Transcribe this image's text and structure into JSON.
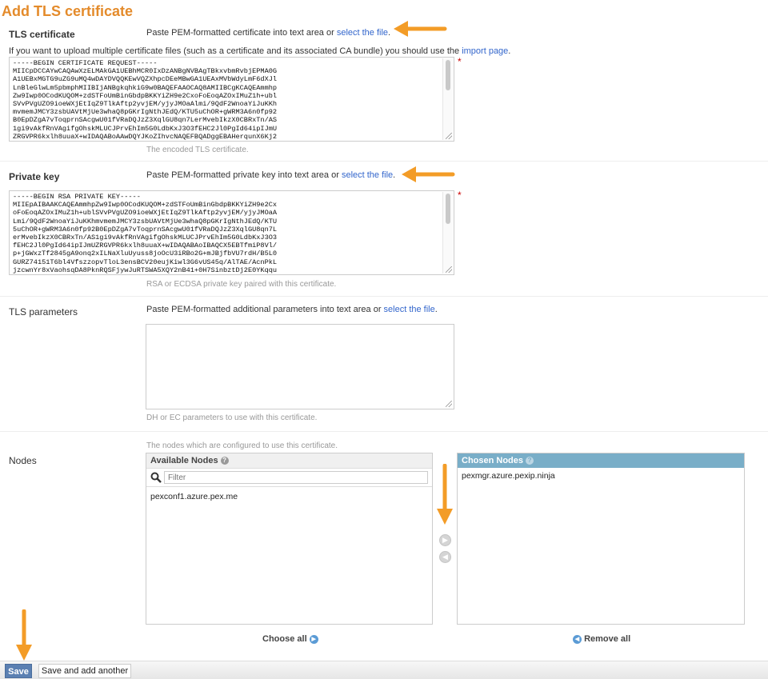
{
  "page": {
    "title": "Add TLS certificate"
  },
  "tls_certificate": {
    "label": "TLS certificate",
    "help_prefix": "Paste PEM-formatted certificate into text area or ",
    "help_link": "select the file",
    "help_suffix": ".",
    "multi_prefix": "If you want to upload multiple certificate files (such as a certificate and its associated CA bundle) you should use the ",
    "multi_link": "import page",
    "multi_suffix": ".",
    "value": "-----BEGIN CERTIFICATE REQUEST-----\nMIICpDCCAYwCAQAwXzELMAkGA1UEBhMCR0IxDzANBgNVBAgTBkxvbmRvbjEPMA0G\nA1UEBxMGTG9uZG9uMQ4wDAYDVQQKEwVQZXhpcDEeMBwGA1UEAxMVbWdyLmF6dXJl\nLnBleGlwLm5pbmphMIIBIjANBgkqhkiG9w0BAQEFAAOCAQ8AMIIBCgKCAQEAmmhp\nZw9Iwp0OCodKUQOM+zdSTFoUmBinGbdpBKKYiZH9e2CxoFoEoqAZOxIMuZ1h+ubl\nSVvPVgUZO9ioeWXjEtIqZ9TlkAftp2yvjEM/yjyJMOaAlmi/9QdF2WnoaYiJuKKh\nmvmemJMCY3zsbUAVtMjUe3whaQ8pGKrIgNthJEdQ/KTU5uChOR+gWRM3A6n0fp92\nB0EpDZgA7vToqprnSAcgwU01fVRaDQJzZ3XqlGU8qn7LerMvebIkzX0CBRxTn/AS\n1gi9vAkfRnVAgifgOhskMLUCJPrvEhIm5G0LdbKxJ3O3fEHC2Jl0PgId64ipIJmU\nZRGVPR6kxlh8uuaX+wIDAQABoAAwDQYJKoZIhvcNAQEFBQADggEBAHerqunX6Kj2",
    "desc": "The encoded TLS certificate.",
    "required_mark": "*"
  },
  "private_key": {
    "label": "Private key",
    "help_prefix": "Paste PEM-formatted private key into text area or ",
    "help_link": "select the file",
    "help_suffix": ".",
    "value": "-----BEGIN RSA PRIVATE KEY-----\nMIIEpAIBAAKCAQEAmmhpZw9Iwp0OCodKUQOM+zdSTFoUmBinGbdpBKKYiZH9e2Cx\noFoEoqAZOxIMuZ1h+ublSVvPVgUZO9ioeWXjEtIqZ9TlkAftp2yvjEM/yjyJMOaA\nLmi/9QdF2WnoaYiJuKKhmvmemJMCY3zsbUAVtMjUe3whaQ8pGKrIgNthJEdQ/KTU\n5uChOR+gWRM3A6n0fp92B0EpDZgA7vToqprnSAcgwU01fVRaDQJzZ3XqlGU8qn7L\nerMvebIkzX0CBRxTn/AS1gi9vAkfRnVAgifgOhskMLUCJPrvEhIm5G0LdbKxJ3O3\nfEHC2Jl0PgId64ipIJmUZRGVPR6kxlh8uuaX+wIDAQABAoIBAQCX5EBTfmiP8Vl/\np+jGWxzTf2845gA9onq2xILNaXluUyuss8joOcU3iRBo2G+mJBjfbVU7rdH/B5L0\nGURZ74151T6bl4VfszzopvTloL3ensBCV20eujKiwl3G6vUS45q/AlTAE/AcnPkL\njzcwnYr8xVaohsqDA8PknRQSFjywJuRTSWA5XQY2nB41+0H7SinbztDj2E0YKqqu",
    "desc": "RSA or ECDSA private key paired with this certificate.",
    "required_mark": "*"
  },
  "tls_parameters": {
    "label": "TLS parameters",
    "help_prefix": "Paste PEM-formatted additional parameters into text area or ",
    "help_link": "select the file",
    "help_suffix": ".",
    "value": "",
    "desc": "DH or EC parameters to use with this certificate."
  },
  "nodes": {
    "label": "Nodes",
    "desc": "The nodes which are configured to use this certificate.",
    "available": {
      "header": "Available Nodes",
      "filter_placeholder": "Filter",
      "items": [
        "pexconf1.azure.pex.me"
      ],
      "choose_all": "Choose all"
    },
    "chosen": {
      "header": "Chosen Nodes",
      "items": [
        "pexmgr.azure.pexip.ninja"
      ],
      "remove_all": "Remove all"
    }
  },
  "actions": {
    "save": "Save",
    "save_and_add": "Save and add another"
  },
  "icons": {
    "help": "question-icon",
    "search": "magnifier-icon",
    "add": "arrow-right-circle-icon",
    "remove": "arrow-left-circle-icon",
    "annotation": "orange-arrow-icon"
  },
  "colors": {
    "title": "#e48b2b",
    "link": "#3366cc",
    "chosen_header": "#79aec8",
    "save_button": "#5b80b2",
    "annotation_arrow": "#f39c27"
  }
}
